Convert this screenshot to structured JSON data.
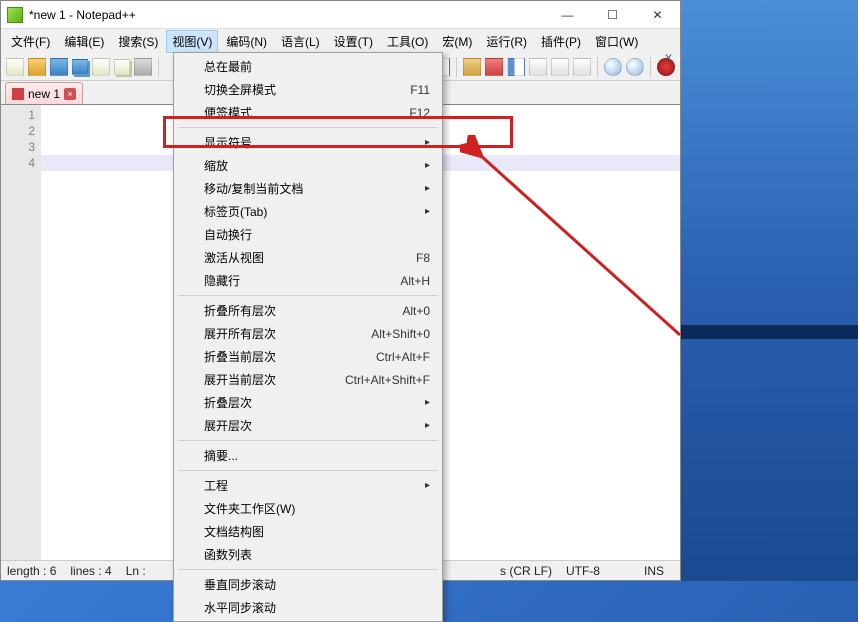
{
  "window": {
    "title": "*new 1 - Notepad++"
  },
  "menubar": [
    "文件(F)",
    "编辑(E)",
    "搜索(S)",
    "视图(V)",
    "编码(N)",
    "语言(L)",
    "设置(T)",
    "工具(O)",
    "宏(M)",
    "运行(R)",
    "插件(P)",
    "窗口(W)"
  ],
  "menubar_active_index": 3,
  "tab": {
    "label": "new 1"
  },
  "gutter_lines": [
    "1",
    "2",
    "3",
    "4"
  ],
  "dropdown": [
    {
      "label": "总在最前",
      "type": "item"
    },
    {
      "label": "切换全屏模式",
      "shortcut": "F11",
      "type": "item"
    },
    {
      "label": "便签模式",
      "shortcut": "F12",
      "type": "item"
    },
    {
      "type": "sep"
    },
    {
      "label": "显示符号",
      "submenu": true,
      "type": "item"
    },
    {
      "label": "缩放",
      "submenu": true,
      "type": "item"
    },
    {
      "label": "移动/复制当前文档",
      "submenu": true,
      "type": "item"
    },
    {
      "label": "标签页(Tab)",
      "submenu": true,
      "type": "item"
    },
    {
      "label": "自动换行",
      "type": "item"
    },
    {
      "label": "激活从视图",
      "shortcut": "F8",
      "type": "item"
    },
    {
      "label": "隐藏行",
      "shortcut": "Alt+H",
      "type": "item"
    },
    {
      "type": "sep"
    },
    {
      "label": "折叠所有层次",
      "shortcut": "Alt+0",
      "type": "item"
    },
    {
      "label": "展开所有层次",
      "shortcut": "Alt+Shift+0",
      "type": "item"
    },
    {
      "label": "折叠当前层次",
      "shortcut": "Ctrl+Alt+F",
      "type": "item"
    },
    {
      "label": "展开当前层次",
      "shortcut": "Ctrl+Alt+Shift+F",
      "type": "item"
    },
    {
      "label": "折叠层次",
      "submenu": true,
      "type": "item"
    },
    {
      "label": "展开层次",
      "submenu": true,
      "type": "item"
    },
    {
      "type": "sep"
    },
    {
      "label": "摘要...",
      "type": "item"
    },
    {
      "type": "sep"
    },
    {
      "label": "工程",
      "submenu": true,
      "type": "item"
    },
    {
      "label": "文件夹工作区(W)",
      "type": "item"
    },
    {
      "label": "文档结构图",
      "type": "item"
    },
    {
      "label": "函数列表",
      "type": "item"
    },
    {
      "type": "sep"
    },
    {
      "label": "垂直同步滚动",
      "type": "item"
    },
    {
      "label": "水平同步滚动",
      "type": "item"
    }
  ],
  "statusbar": {
    "length": "length : 6",
    "lines": "lines : 4",
    "ln": "Ln :",
    "eol": "s (CR LF)",
    "encoding": "UTF-8",
    "mode": "INS"
  },
  "menubar_close": "x"
}
